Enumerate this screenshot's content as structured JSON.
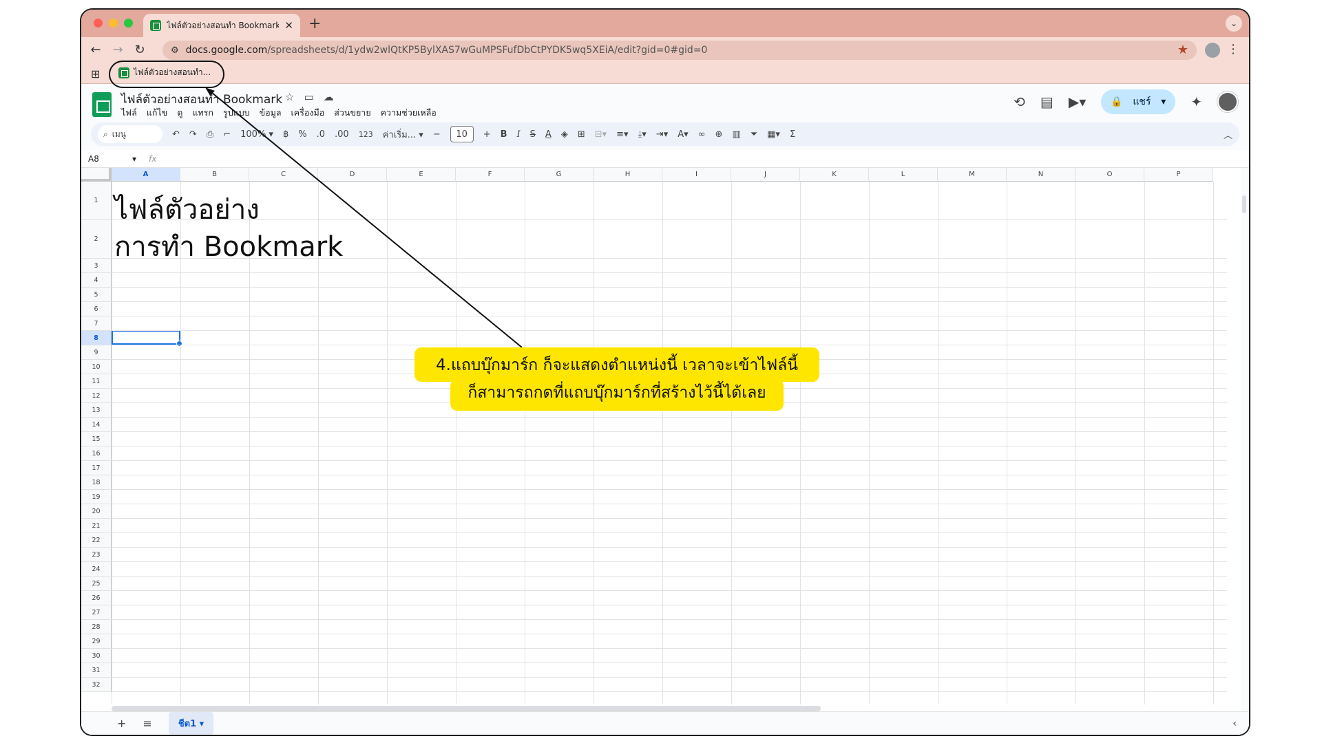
{
  "browser": {
    "tab_title": "ไฟล์ตัวอย่างสอนทำ Bookmark -",
    "tab_close": "✕",
    "new_tab": "+",
    "url_domain": "docs.google.com",
    "url_path": "/spreadsheets/d/1ydw2wlQtKP5BylXAS7wGuMPSFufDbCtPYDK5wq5XEiA/edit?gid=0#gid=0",
    "bookmark_label": "ไฟล์ตัวอย่างสอนทำ..."
  },
  "sheets": {
    "doc_title": "ไฟล์ตัวอย่างสอนทำ Bookmark",
    "menu": [
      "ไฟล์",
      "แก้ไข",
      "ดู",
      "แทรก",
      "รูปแบบ",
      "ข้อมูล",
      "เครื่องมือ",
      "ส่วนขยาย",
      "ความช่วยเหลือ"
    ],
    "share_label": "แชร์",
    "toolbar": {
      "search": "เมนู",
      "zoom": "100%",
      "currency": "฿",
      "percent": "%",
      "dec_decrease": ".0",
      "dec_increase": ".00",
      "number_format": "123",
      "font": "ค่าเริ่ม...",
      "font_size": "10",
      "bold": "B",
      "italic": "I",
      "sum": "Σ"
    },
    "name_box": "A8",
    "fx": "fx",
    "columns": [
      "A",
      "B",
      "C",
      "D",
      "E",
      "F",
      "G",
      "H",
      "I",
      "J",
      "K",
      "L",
      "M",
      "N",
      "O",
      "P"
    ],
    "rows": [
      "1",
      "2",
      "3",
      "4",
      "5",
      "6",
      "7",
      "8",
      "9",
      "10",
      "11",
      "12",
      "13",
      "14",
      "15",
      "16",
      "17",
      "18",
      "19",
      "20",
      "21",
      "22",
      "23",
      "24",
      "25",
      "26",
      "27",
      "28",
      "29",
      "30",
      "31",
      "32"
    ],
    "cells": {
      "a1": "ไฟล์ตัวอย่าง",
      "a2": "การทำ Bookmark"
    },
    "selected_cell": "A8",
    "sheet_tab": "ชีต1"
  },
  "annotation": {
    "line1": "4.แถบบุ๊กมาร์ก ก็จะแสดงตำแหน่งนี้  เวลาจะเข้าไฟล์นี้",
    "line2": "ก็สามารถกดที่แถบบุ๊กมาร์กที่สร้างไว้นี้ได้เลย",
    "highlight_color": "#ffe600"
  },
  "colors": {
    "tab_bar": "#e2a99c",
    "chrome": "#f6dcd5",
    "accent": "#1a73e8",
    "sheets_green": "#0f9d58",
    "share_bg": "#c2e7ff"
  }
}
